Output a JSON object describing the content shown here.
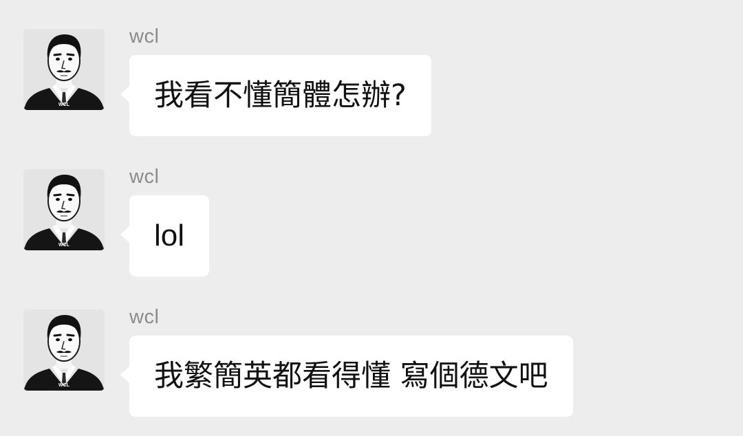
{
  "messages": [
    {
      "sender": "wcl",
      "avatar_label": "WCL",
      "text": "我看不懂簡體怎辦?"
    },
    {
      "sender": "wcl",
      "avatar_label": "WCL",
      "text": "lol"
    },
    {
      "sender": "wcl",
      "avatar_label": "WCL",
      "text": "我繁簡英都看得懂 寫個德文吧"
    }
  ]
}
